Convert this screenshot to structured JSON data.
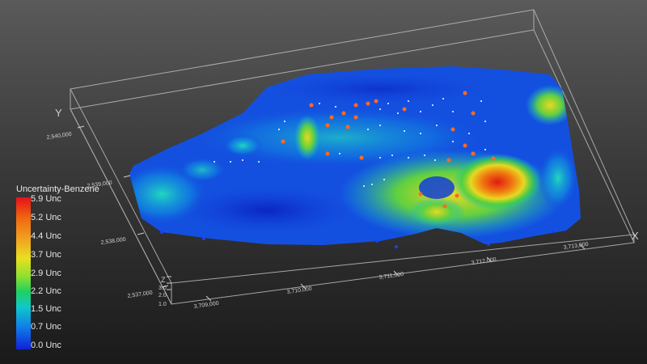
{
  "legend": {
    "title": "Uncertainty-Benzene",
    "entries": [
      "5.9 Unc",
      "5.2 Unc",
      "4.4 Unc",
      "3.7 Unc",
      "2.9 Unc",
      "2.2 Unc",
      "1.5 Unc",
      "0.7 Unc",
      "0.0 Unc"
    ],
    "colors": [
      "#e8101a",
      "#1020d8"
    ]
  },
  "axes": {
    "x_name": "X",
    "y_name": "Y",
    "z_name": "Z",
    "x_ticks": [
      "3,709,000",
      "3,710,000",
      "3,711,000",
      "3,712,000",
      "3,713,000"
    ],
    "y_ticks": [
      "2,537,000",
      "2,538,000",
      "2,539,000",
      "2,540,000"
    ],
    "z_ticks": [
      "3.0",
      "2.0",
      "1.0"
    ]
  }
}
